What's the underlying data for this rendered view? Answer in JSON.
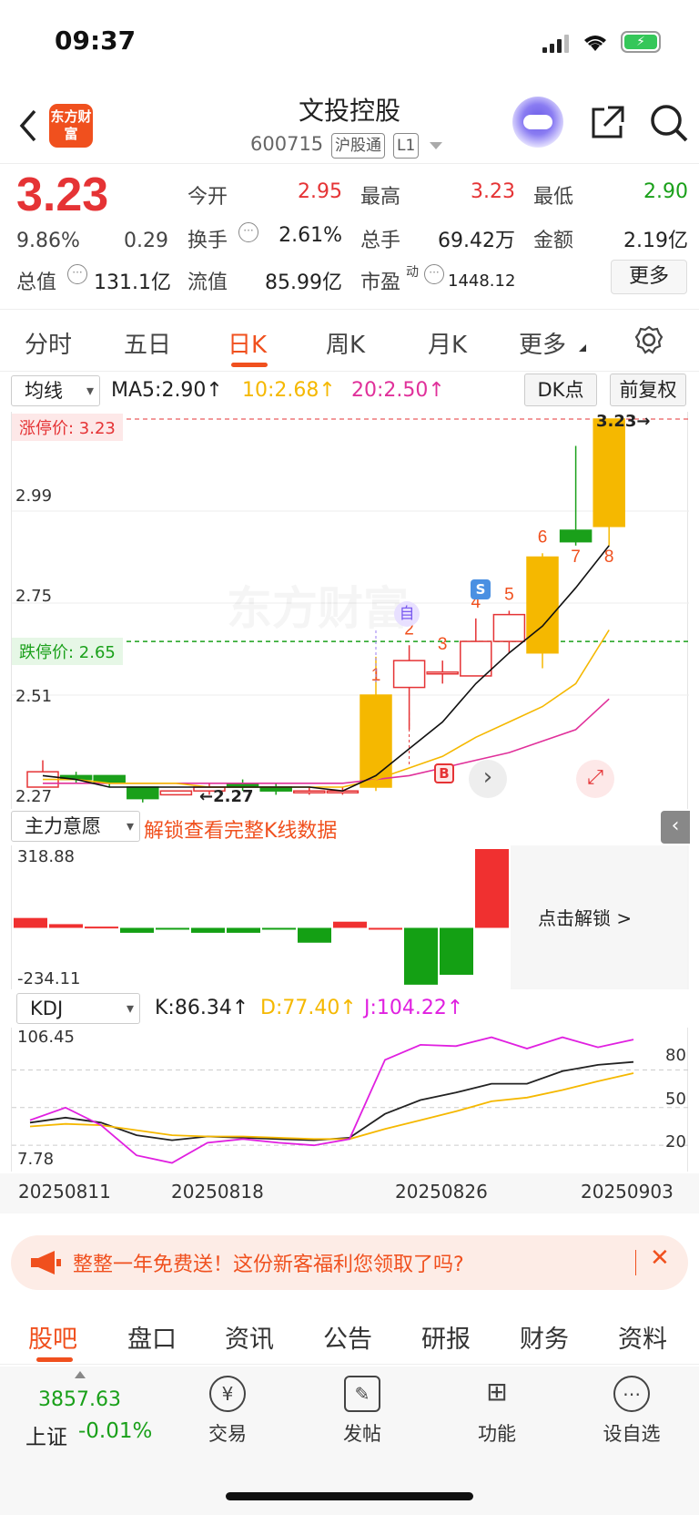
{
  "status_bar": {
    "time": "09:37"
  },
  "header": {
    "logo": "东方财富",
    "title": "文投控股",
    "code": "600715",
    "tags": [
      "沪股通",
      "L1"
    ]
  },
  "quote": {
    "price": "3.23",
    "change_pct": "9.86%",
    "change": "0.29",
    "stats": {
      "open_label": "今开",
      "open": "2.95",
      "high_label": "最高",
      "high": "3.23",
      "low_label": "最低",
      "low": "2.90",
      "turnover_label": "换手",
      "turnover": "2.61%",
      "volume_label": "总手",
      "volume": "69.42万",
      "amount_label": "金额",
      "amount": "2.19亿",
      "mktcap_label": "总值",
      "mktcap": "131.1亿",
      "float_label": "流值",
      "float": "85.99亿",
      "pe_label": "市盈",
      "pe_sup": "动",
      "pe": "1448.12"
    },
    "more_label": "更多"
  },
  "period_tabs": [
    "分时",
    "五日",
    "日K",
    "周K",
    "月K",
    "更多"
  ],
  "active_tab": "日K",
  "ma_bar": {
    "selector": "均线",
    "ma5": "MA5:2.90↑",
    "ma10": "10:2.68↑",
    "ma20": "20:2.50↑",
    "dk_btn": "DK点",
    "adj_btn": "前复权"
  },
  "kline": {
    "limit_up": "涨停价: 3.23",
    "limit_down": "跌停价: 2.65",
    "y_ticks": [
      "3.23",
      "2.99",
      "2.75",
      "2.51",
      "2.27"
    ],
    "min_marker": "←2.27",
    "max_marker": "3.23→",
    "signal_labels": [
      "1",
      "2",
      "3",
      "4",
      "5",
      "6",
      "7",
      "8"
    ],
    "badge_self": "自",
    "badge_buy": "B",
    "badge_sell": "S",
    "watermark": "东方财富"
  },
  "chart_data": [
    {
      "type": "candlestick",
      "ylim": [
        2.27,
        3.23
      ],
      "candles": [
        {
          "o": 2.27,
          "h": 2.34,
          "l": 2.27,
          "c": 2.31
        },
        {
          "o": 2.3,
          "h": 2.31,
          "l": 2.28,
          "c": 2.29
        },
        {
          "o": 2.3,
          "h": 2.3,
          "l": 2.27,
          "c": 2.28
        },
        {
          "o": 2.27,
          "h": 2.27,
          "l": 2.23,
          "c": 2.24
        },
        {
          "o": 2.25,
          "h": 2.26,
          "l": 2.25,
          "c": 2.26
        },
        {
          "o": 2.26,
          "h": 2.28,
          "l": 2.25,
          "c": 2.27
        },
        {
          "o": 2.28,
          "h": 2.29,
          "l": 2.26,
          "c": 2.27
        },
        {
          "o": 2.27,
          "h": 2.28,
          "l": 2.25,
          "c": 2.26
        },
        {
          "o": 2.26,
          "h": 2.27,
          "l": 2.25,
          "c": 2.26
        },
        {
          "o": 2.26,
          "h": 2.27,
          "l": 2.25,
          "c": 2.26
        },
        {
          "o": 2.27,
          "h": 2.61,
          "l": 2.26,
          "c": 2.51
        },
        {
          "o": 2.53,
          "h": 2.64,
          "l": 2.42,
          "c": 2.6
        },
        {
          "o": 2.57,
          "h": 2.6,
          "l": 2.54,
          "c": 2.57
        },
        {
          "o": 2.56,
          "h": 2.71,
          "l": 2.56,
          "c": 2.65
        },
        {
          "o": 2.65,
          "h": 2.73,
          "l": 2.62,
          "c": 2.72
        },
        {
          "o": 2.62,
          "h": 2.88,
          "l": 2.58,
          "c": 2.87
        },
        {
          "o": 2.94,
          "h": 3.16,
          "l": 2.9,
          "c": 2.91
        },
        {
          "o": 2.95,
          "h": 3.23,
          "l": 2.9,
          "c": 3.23
        }
      ],
      "ma5": [
        2.3,
        2.29,
        2.27,
        2.27,
        2.27,
        2.27,
        2.27,
        2.27,
        2.27,
        2.26,
        2.3,
        2.37,
        2.44,
        2.54,
        2.62,
        2.69,
        2.79,
        2.9
      ],
      "ma10": [
        2.29,
        2.29,
        2.28,
        2.28,
        2.28,
        2.27,
        2.27,
        2.27,
        2.27,
        2.27,
        2.29,
        2.32,
        2.35,
        2.4,
        2.44,
        2.48,
        2.54,
        2.68
      ],
      "ma20": [
        2.28,
        2.28,
        2.28,
        2.28,
        2.28,
        2.28,
        2.28,
        2.28,
        2.28,
        2.28,
        2.29,
        2.3,
        2.32,
        2.34,
        2.36,
        2.39,
        2.42,
        2.5
      ]
    },
    {
      "type": "bar",
      "title": "主力意愿",
      "ylim": [
        -234.11,
        318.88
      ],
      "values": [
        40,
        15,
        5,
        -20,
        -5,
        -20,
        -20,
        -5,
        -60,
        25,
        0,
        -230,
        -190,
        318.88
      ]
    },
    {
      "type": "line",
      "title": "KDJ",
      "ylim": [
        7.78,
        106.45
      ],
      "ref_lines": [
        20,
        50,
        80
      ],
      "series": [
        {
          "name": "K",
          "values": [
            38,
            42,
            38,
            28,
            24,
            27,
            26,
            25,
            24,
            26,
            45,
            56,
            62,
            69,
            69,
            79,
            84,
            86.34
          ]
        },
        {
          "name": "D",
          "values": [
            35,
            37,
            36,
            32,
            28,
            27,
            27,
            26,
            25,
            25,
            33,
            40,
            47,
            55,
            58,
            64,
            71,
            77.4
          ]
        },
        {
          "name": "J",
          "values": [
            40,
            50,
            36,
            12,
            6,
            22,
            25,
            22,
            20,
            25,
            88,
            100,
            99,
            106,
            97,
            106,
            98,
            104.22
          ]
        }
      ]
    }
  ],
  "main_force": {
    "selector": "主力意愿",
    "unlock_text": "解锁查看完整K线数据",
    "max": "318.88",
    "min": "-234.11",
    "unlock_btn": "点击解锁 >"
  },
  "kdj_bar": {
    "selector": "KDJ",
    "k": "K:86.34↑",
    "d": "D:77.40↑",
    "j": "J:104.22↑",
    "max": "106.45",
    "min": "7.78",
    "ref": [
      "80",
      "50",
      "20"
    ]
  },
  "x_dates": [
    "20250811",
    "20250818",
    "20250826",
    "20250903"
  ],
  "banner": {
    "text": "整整一年免费送！这份新客福利您领取了吗?"
  },
  "bottom_tabs": [
    "股吧",
    "盘口",
    "资讯",
    "公告",
    "研报",
    "财务",
    "资料"
  ],
  "index": {
    "value": "3857.63",
    "label": "上证",
    "change": "-0.01%"
  },
  "nav": [
    "交易",
    "发帖",
    "功能",
    "设自选"
  ],
  "colors": {
    "up": "#e53335",
    "down": "#1aa01a",
    "accent": "#f0501e",
    "yellow": "#f5b800"
  }
}
